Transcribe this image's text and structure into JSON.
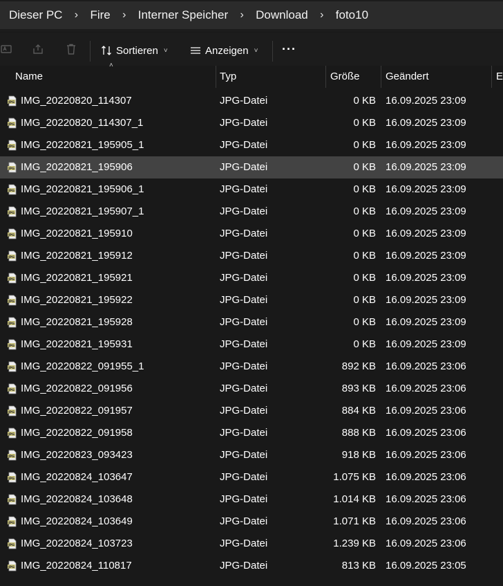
{
  "breadcrumb": {
    "items": [
      "Dieser PC",
      "Fire",
      "Interner Speicher",
      "Download",
      "foto10"
    ],
    "separator": "›"
  },
  "toolbar": {
    "sort_label": "Sortieren",
    "view_label": "Anzeigen",
    "more_label": "···"
  },
  "columns": {
    "name": "Name",
    "type": "Typ",
    "size": "Größe",
    "modified": "Geändert",
    "extra": "Er"
  },
  "files": [
    {
      "name": "IMG_20220820_114307",
      "type": "JPG-Datei",
      "size": "0 KB",
      "modified": "16.09.2025 23:09"
    },
    {
      "name": "IMG_20220820_114307_1",
      "type": "JPG-Datei",
      "size": "0 KB",
      "modified": "16.09.2025 23:09"
    },
    {
      "name": "IMG_20220821_195905_1",
      "type": "JPG-Datei",
      "size": "0 KB",
      "modified": "16.09.2025 23:09"
    },
    {
      "name": "IMG_20220821_195906",
      "type": "JPG-Datei",
      "size": "0 KB",
      "modified": "16.09.2025 23:09",
      "selected": true
    },
    {
      "name": "IMG_20220821_195906_1",
      "type": "JPG-Datei",
      "size": "0 KB",
      "modified": "16.09.2025 23:09"
    },
    {
      "name": "IMG_20220821_195907_1",
      "type": "JPG-Datei",
      "size": "0 KB",
      "modified": "16.09.2025 23:09"
    },
    {
      "name": "IMG_20220821_195910",
      "type": "JPG-Datei",
      "size": "0 KB",
      "modified": "16.09.2025 23:09"
    },
    {
      "name": "IMG_20220821_195912",
      "type": "JPG-Datei",
      "size": "0 KB",
      "modified": "16.09.2025 23:09"
    },
    {
      "name": "IMG_20220821_195921",
      "type": "JPG-Datei",
      "size": "0 KB",
      "modified": "16.09.2025 23:09"
    },
    {
      "name": "IMG_20220821_195922",
      "type": "JPG-Datei",
      "size": "0 KB",
      "modified": "16.09.2025 23:09"
    },
    {
      "name": "IMG_20220821_195928",
      "type": "JPG-Datei",
      "size": "0 KB",
      "modified": "16.09.2025 23:09"
    },
    {
      "name": "IMG_20220821_195931",
      "type": "JPG-Datei",
      "size": "0 KB",
      "modified": "16.09.2025 23:09"
    },
    {
      "name": "IMG_20220822_091955_1",
      "type": "JPG-Datei",
      "size": "892 KB",
      "modified": "16.09.2025 23:06"
    },
    {
      "name": "IMG_20220822_091956",
      "type": "JPG-Datei",
      "size": "893 KB",
      "modified": "16.09.2025 23:06"
    },
    {
      "name": "IMG_20220822_091957",
      "type": "JPG-Datei",
      "size": "884 KB",
      "modified": "16.09.2025 23:06"
    },
    {
      "name": "IMG_20220822_091958",
      "type": "JPG-Datei",
      "size": "888 KB",
      "modified": "16.09.2025 23:06"
    },
    {
      "name": "IMG_20220823_093423",
      "type": "JPG-Datei",
      "size": "918 KB",
      "modified": "16.09.2025 23:06"
    },
    {
      "name": "IMG_20220824_103647",
      "type": "JPG-Datei",
      "size": "1.075 KB",
      "modified": "16.09.2025 23:06"
    },
    {
      "name": "IMG_20220824_103648",
      "type": "JPG-Datei",
      "size": "1.014 KB",
      "modified": "16.09.2025 23:06"
    },
    {
      "name": "IMG_20220824_103649",
      "type": "JPG-Datei",
      "size": "1.071 KB",
      "modified": "16.09.2025 23:06"
    },
    {
      "name": "IMG_20220824_103723",
      "type": "JPG-Datei",
      "size": "1.239 KB",
      "modified": "16.09.2025 23:06"
    },
    {
      "name": "IMG_20220824_110817",
      "type": "JPG-Datei",
      "size": "813 KB",
      "modified": "16.09.2025 23:05"
    }
  ],
  "icons": {
    "rename": "rename-icon",
    "share": "share-icon",
    "delete": "trash-icon",
    "sort": "sort-arrows-icon",
    "view": "view-list-icon",
    "file": "jpg-file-icon"
  },
  "colors": {
    "background": "#191919",
    "selected_row": "#434343",
    "breadcrumb_bg": "#2b2b2b",
    "jpg_icon": "#c9c27a"
  }
}
